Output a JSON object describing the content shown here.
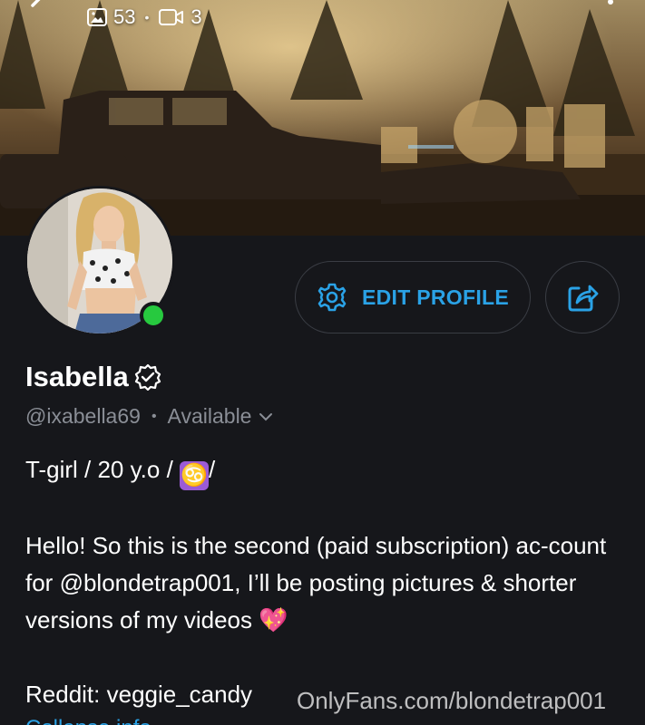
{
  "banner": {
    "photo_count": "53",
    "video_count": "3",
    "separator": "•"
  },
  "profile": {
    "name": "Isabella",
    "handle": "@ixabella69",
    "handle_separator": "•",
    "status": "Available",
    "online": true
  },
  "actions": {
    "edit_profile_label": "EDIT PROFILE"
  },
  "bio": {
    "line1_text": "T-girl / 20 y.o / ",
    "line1_emoji": "♋",
    "line1_tail": "/",
    "para2_text": "Hello! So this is the second (paid subscription) ac-count for @blondetrap001, I’ll be posting pictures & shorter versions of my videos ",
    "para2_emoji": "💖",
    "reddit_line": "Reddit: veggie_candy",
    "peek_link": "Collapse info"
  },
  "watermark": "OnlyFans.com/blondetrap001",
  "colors": {
    "accent": "#2aa2e6",
    "background": "#16171b",
    "online": "#27c93f",
    "muted": "#8a8e96"
  },
  "icons": [
    "back-arrow-icon",
    "image-icon",
    "video-icon",
    "more-vertical-icon",
    "gear-icon",
    "share-icon",
    "verified-badge-icon",
    "chevron-down-icon"
  ]
}
